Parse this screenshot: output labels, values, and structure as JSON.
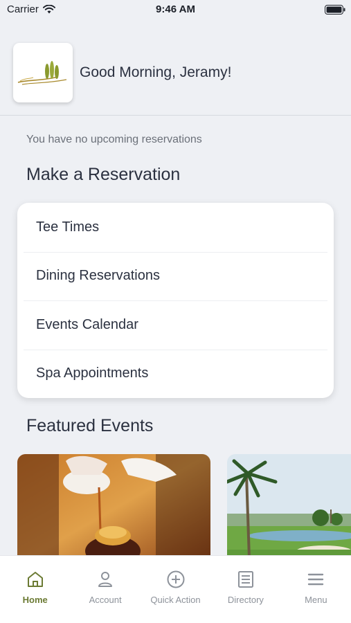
{
  "status_bar": {
    "carrier": "Carrier",
    "time": "9:46 AM"
  },
  "header": {
    "greeting": "Good Morning, Jeramy!",
    "logo_icon": "club-logo-icon"
  },
  "reservations": {
    "empty_message": "You have no upcoming reservations",
    "section_title": "Make a Reservation",
    "items": [
      {
        "label": "Tee Times"
      },
      {
        "label": "Dining Reservations"
      },
      {
        "label": "Events Calendar"
      },
      {
        "label": "Spa Appointments"
      }
    ]
  },
  "featured": {
    "section_title": "Featured Events",
    "events": [
      {
        "image_icon": "dining-dish-image"
      },
      {
        "image_icon": "golf-course-image"
      }
    ]
  },
  "tab_bar": {
    "active_color": "#6b7a33",
    "inactive_color": "#8d929a",
    "tabs": [
      {
        "label": "Home",
        "icon": "home-icon"
      },
      {
        "label": "Account",
        "icon": "account-icon"
      },
      {
        "label": "Quick Action",
        "icon": "plus-circle-icon"
      },
      {
        "label": "Directory",
        "icon": "directory-icon"
      },
      {
        "label": "Menu",
        "icon": "hamburger-menu-icon"
      }
    ]
  }
}
